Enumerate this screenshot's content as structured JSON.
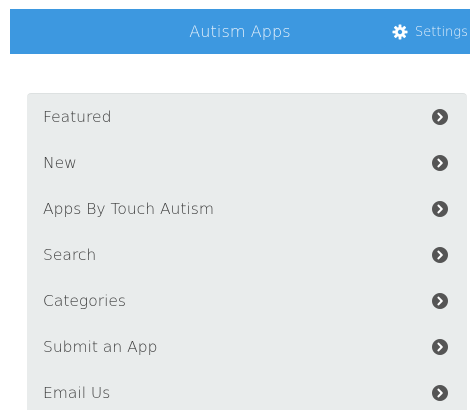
{
  "header": {
    "title": "Autism Apps",
    "settings_label": "Settings",
    "settings_icon": "gear-icon"
  },
  "menu": {
    "items": [
      {
        "label": "Featured",
        "icon": "chevron-right-circle-icon"
      },
      {
        "label": "New",
        "icon": "chevron-right-circle-icon"
      },
      {
        "label": "Apps By Touch Autism",
        "icon": "chevron-right-circle-icon"
      },
      {
        "label": "Search",
        "icon": "chevron-right-circle-icon"
      },
      {
        "label": "Categories",
        "icon": "chevron-right-circle-icon"
      },
      {
        "label": "Submit an App",
        "icon": "chevron-right-circle-icon"
      },
      {
        "label": "Email Us",
        "icon": "chevron-right-circle-icon"
      }
    ]
  },
  "colors": {
    "header_background": "#3d98e0",
    "header_text": "#e8f2fb",
    "menu_background": "#e9ecec",
    "menu_text": "#3a3a3a",
    "chevron": "#555555"
  }
}
